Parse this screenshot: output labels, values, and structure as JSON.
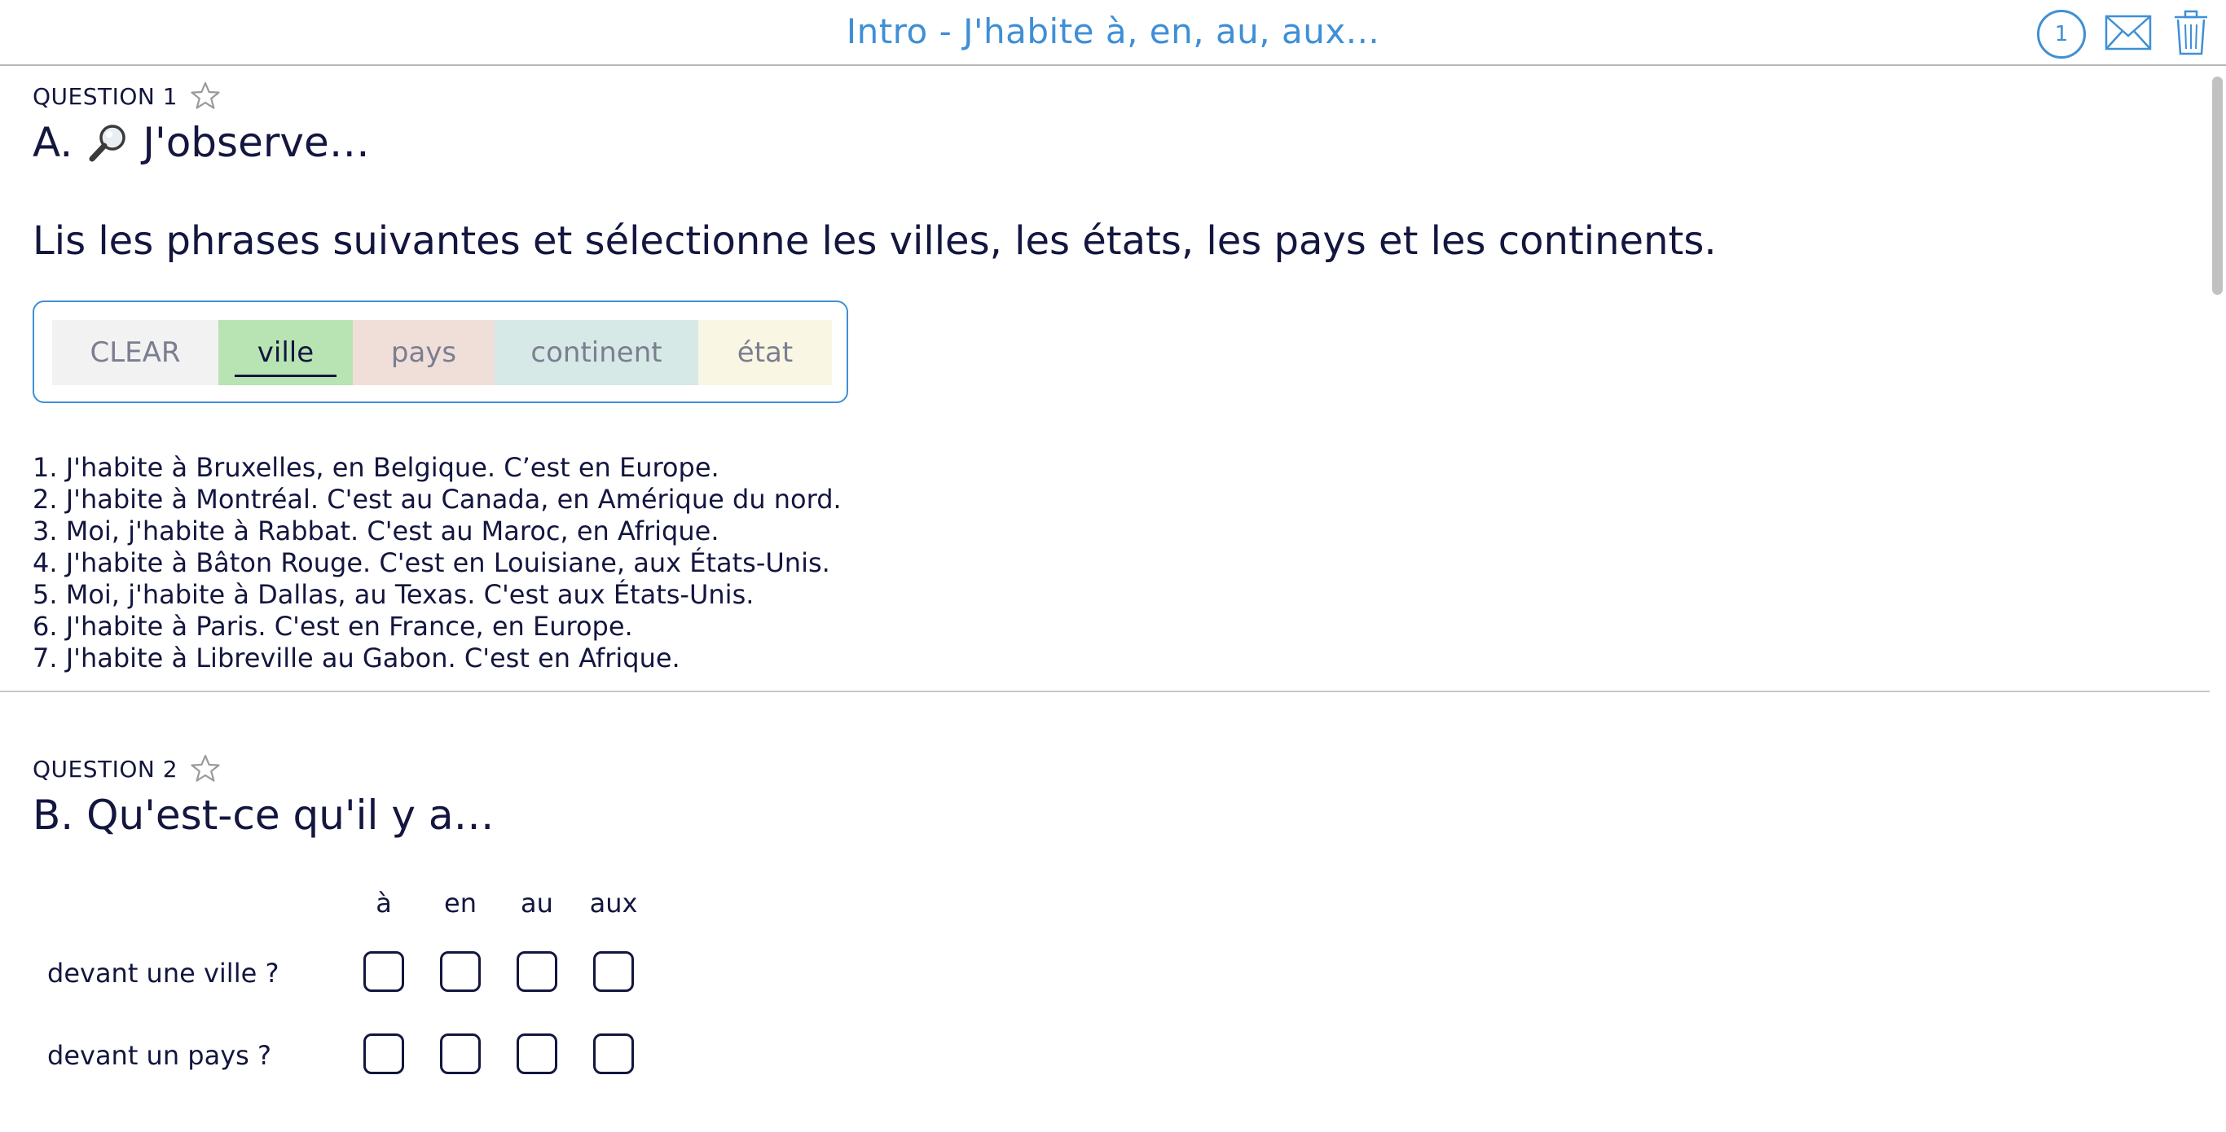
{
  "header": {
    "title": "Intro - J'habite à, en, au, aux...",
    "progress_count": "1"
  },
  "icons": {
    "mail": "mail-icon",
    "trash": "trash-icon",
    "star": "star-outline-icon",
    "magnifier": "magnifier-icon"
  },
  "colors": {
    "accent": "#3f8fd6",
    "text": "#13163f",
    "ville": "#b7e4b2",
    "pays": "#f0dfd9",
    "continent": "#d6e9e7",
    "etat": "#faf6e4",
    "clear": "#f2f2f2"
  },
  "question1": {
    "label": "QUESTION 1",
    "title_prefix": "A.",
    "title_text": "J'observe…",
    "instruction": "Lis les phrases suivantes et sélectionne les villes, les états, les pays et les continents.",
    "chips": {
      "clear": "CLEAR",
      "ville": "ville",
      "pays": "pays",
      "continent": "continent",
      "etat": "état"
    },
    "selected_chip": "ville",
    "sentences": [
      "1. J'habite à Bruxelles, en Belgique. C’est en Europe.",
      "2. J'habite à Montréal. C'est au Canada, en Amérique du nord.",
      "3. Moi, j'habite à Rabbat. C'est au Maroc, en Afrique.",
      "4. J'habite à Bâton Rouge. C'est en Louisiane, aux États-Unis.",
      "5. Moi, j'habite à Dallas, au Texas. C'est aux États-Unis.",
      "6. J'habite à Paris. C'est en France, en Europe.",
      "7. J'habite à Libreville au Gabon. C'est en Afrique."
    ]
  },
  "question2": {
    "label": "QUESTION 2",
    "title": "B. Qu'est-ce qu'il y a…",
    "columns": [
      "à",
      "en",
      "au",
      "aux"
    ],
    "rows": [
      "devant une ville ?",
      "devant un pays ?"
    ]
  }
}
